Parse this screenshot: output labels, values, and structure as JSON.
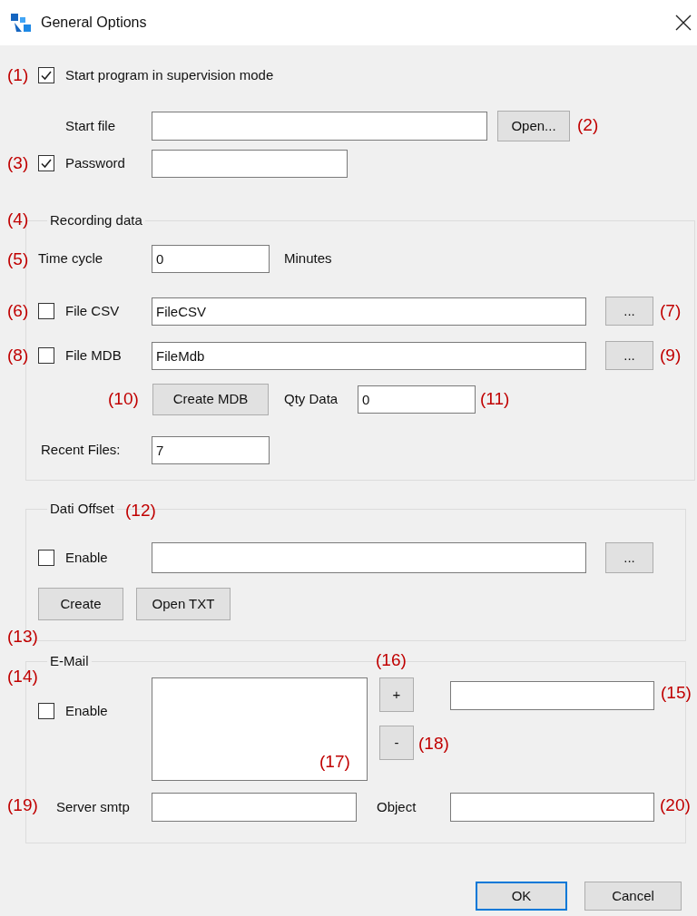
{
  "window": {
    "title": "General Options"
  },
  "supervision": {
    "annotation": "(1)",
    "label": "Start program in supervision mode",
    "checked": true
  },
  "start_file": {
    "label": "Start file",
    "button": "Open...",
    "annotation": "(2)"
  },
  "password": {
    "annotation": "(3)",
    "label": "Password",
    "checked": true
  },
  "recording": {
    "annotation": "(4)",
    "title": "Recording data",
    "time_cycle": {
      "annotation": "(5)",
      "label": "Time cycle",
      "value": "0",
      "unit": "Minutes"
    },
    "files": [
      {
        "annotation": "(6)",
        "label": "File CSV",
        "checked": false,
        "value": "FileCSV",
        "button": "...",
        "button_annotation": "(7)"
      },
      {
        "annotation": "(8)",
        "label": "File MDB",
        "checked": false,
        "value": "FileMdb",
        "button": "...",
        "button_annotation": "(9)"
      }
    ],
    "create": {
      "annotation": "(10)",
      "button": "Create MDB",
      "qty_label": "Qty Data",
      "qty_value": "0",
      "qty_annotation": "(11)"
    },
    "recent": {
      "label": "Recent Files:",
      "value": "7"
    }
  },
  "offset": {
    "title": "Dati Offset",
    "annotation": "(12)",
    "enable": {
      "label": "Enable",
      "checked": false
    },
    "browse": "...",
    "buttons": [
      "Create",
      "Open TXT"
    ]
  },
  "email": {
    "group_annotation": "(13)",
    "title": "E-Mail",
    "enable_annotation": "(14)",
    "enable": {
      "label": "Enable",
      "checked": false
    },
    "list_annotation": "(17)",
    "add": {
      "label": "+",
      "annotation": "(16)"
    },
    "address_annotation": "(15)",
    "remove": {
      "label": "-",
      "annotation": "(18)"
    },
    "server": {
      "annotation": "(19)",
      "label": "Server smtp"
    },
    "object": {
      "label": "Object",
      "annotation": "(20)"
    }
  },
  "buttons": [
    {
      "label": "OK",
      "default": true
    },
    {
      "label": "Cancel",
      "default": false
    }
  ]
}
